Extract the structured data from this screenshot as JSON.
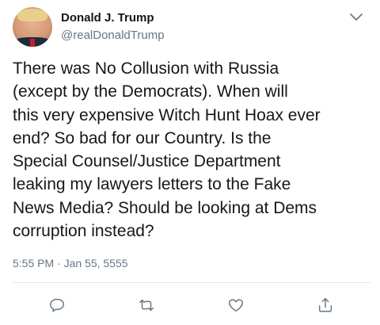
{
  "tweet": {
    "author": {
      "display_name": "Donald J. Trump",
      "handle": "@realDonaldTrump"
    },
    "text": "There was No Collusion with Russia\n(except by the Democrats). When will\nthis very expensive Witch Hunt Hoax ever\nend? So bad for our Country. Is the\nSpecial Counsel/Justice Department\nleaking my lawyers letters to the Fake\nNews Media? Should be looking at Dems\ncorruption instead?",
    "timestamp": "5:55 PM · Jan 55, 5555"
  },
  "actions": [
    {
      "icon": "reply-icon"
    },
    {
      "icon": "retweet-icon"
    },
    {
      "icon": "like-icon"
    },
    {
      "icon": "share-icon"
    }
  ],
  "colors": {
    "text": "#14171a",
    "secondary": "#657786",
    "divider": "#e1e8ed",
    "icon": "#657786"
  }
}
